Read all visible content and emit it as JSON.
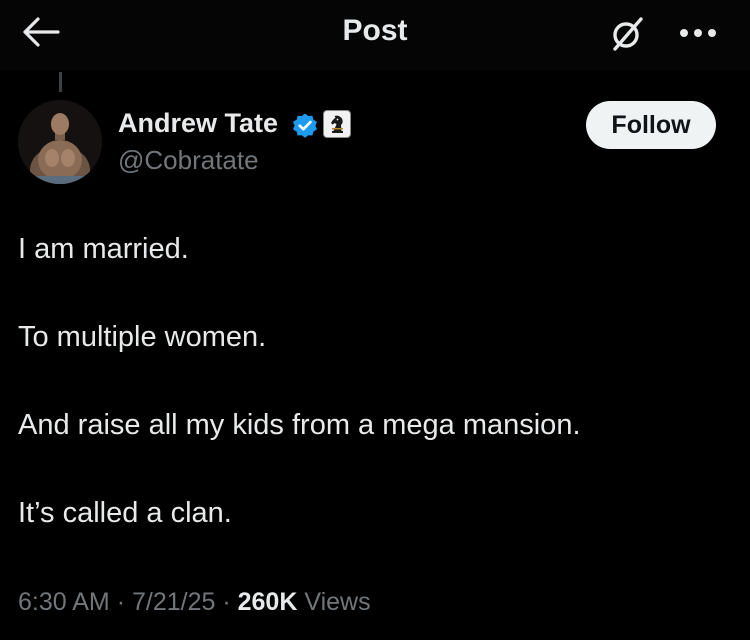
{
  "header": {
    "title": "Post",
    "back_icon": "arrow-left-icon",
    "grok_icon": "grok-icon",
    "more_icon": "more-horizontal-icon"
  },
  "author": {
    "name": "Andrew Tate",
    "handle": "@Cobratate",
    "verified_icon": "verified-badge-icon",
    "affiliation_icon": "chess-knight-badge-icon",
    "follow_label": "Follow"
  },
  "post": {
    "lines": [
      "I am married.",
      "To multiple women.",
      "And raise all my kids from a mega mansion.",
      "It’s called a clan."
    ],
    "time": "6:30 AM",
    "date": "7/21/25",
    "views_count": "260K",
    "views_label": "Views",
    "separator": "·"
  },
  "colors": {
    "background": "#000000",
    "text_primary": "#e7e9ea",
    "text_secondary": "#71767b",
    "verified_blue": "#1d9bf0",
    "follow_bg": "#eff3f4"
  }
}
